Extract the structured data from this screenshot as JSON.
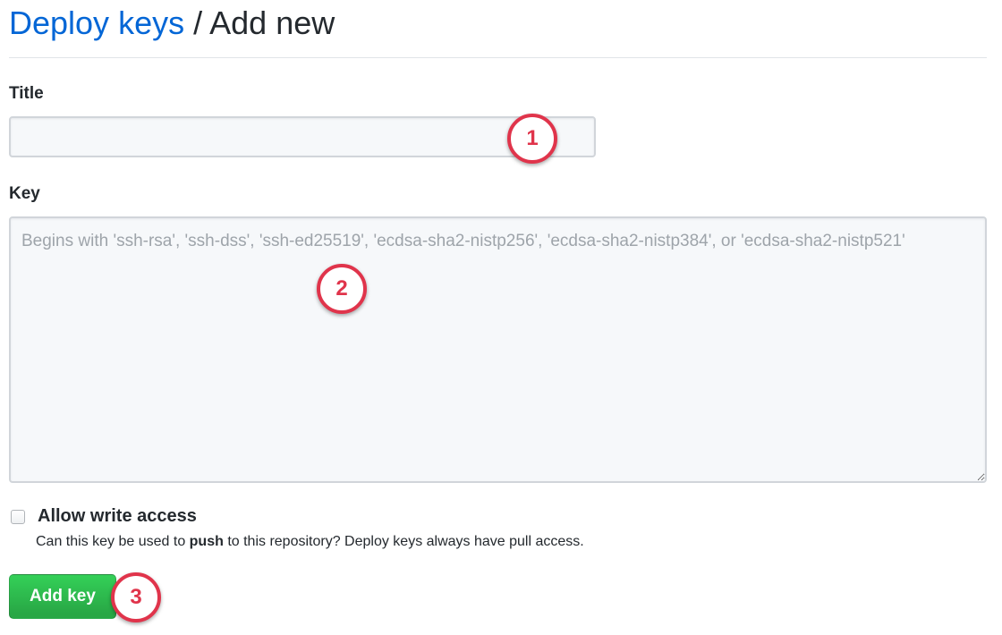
{
  "header": {
    "breadcrumb_link": "Deploy keys",
    "separator": "/",
    "current": "Add new"
  },
  "form": {
    "title_label": "Title",
    "title_value": "",
    "key_label": "Key",
    "key_value": "",
    "key_placeholder": "Begins with 'ssh-rsa', 'ssh-dss', 'ssh-ed25519', 'ecdsa-sha2-nistp256', 'ecdsa-sha2-nistp384', or 'ecdsa-sha2-nistp521'",
    "write_access_label": "Allow write access",
    "write_access_checked": false,
    "note_before": "Can this key be used to ",
    "note_bold": "push",
    "note_after": " to this repository? Deploy keys always have pull access.",
    "submit_label": "Add key"
  },
  "annotations": {
    "step1": "1",
    "step2": "2",
    "step3": "3"
  },
  "colors": {
    "link": "#0366d6",
    "button": "#28a745",
    "callout": "#e0344b"
  }
}
